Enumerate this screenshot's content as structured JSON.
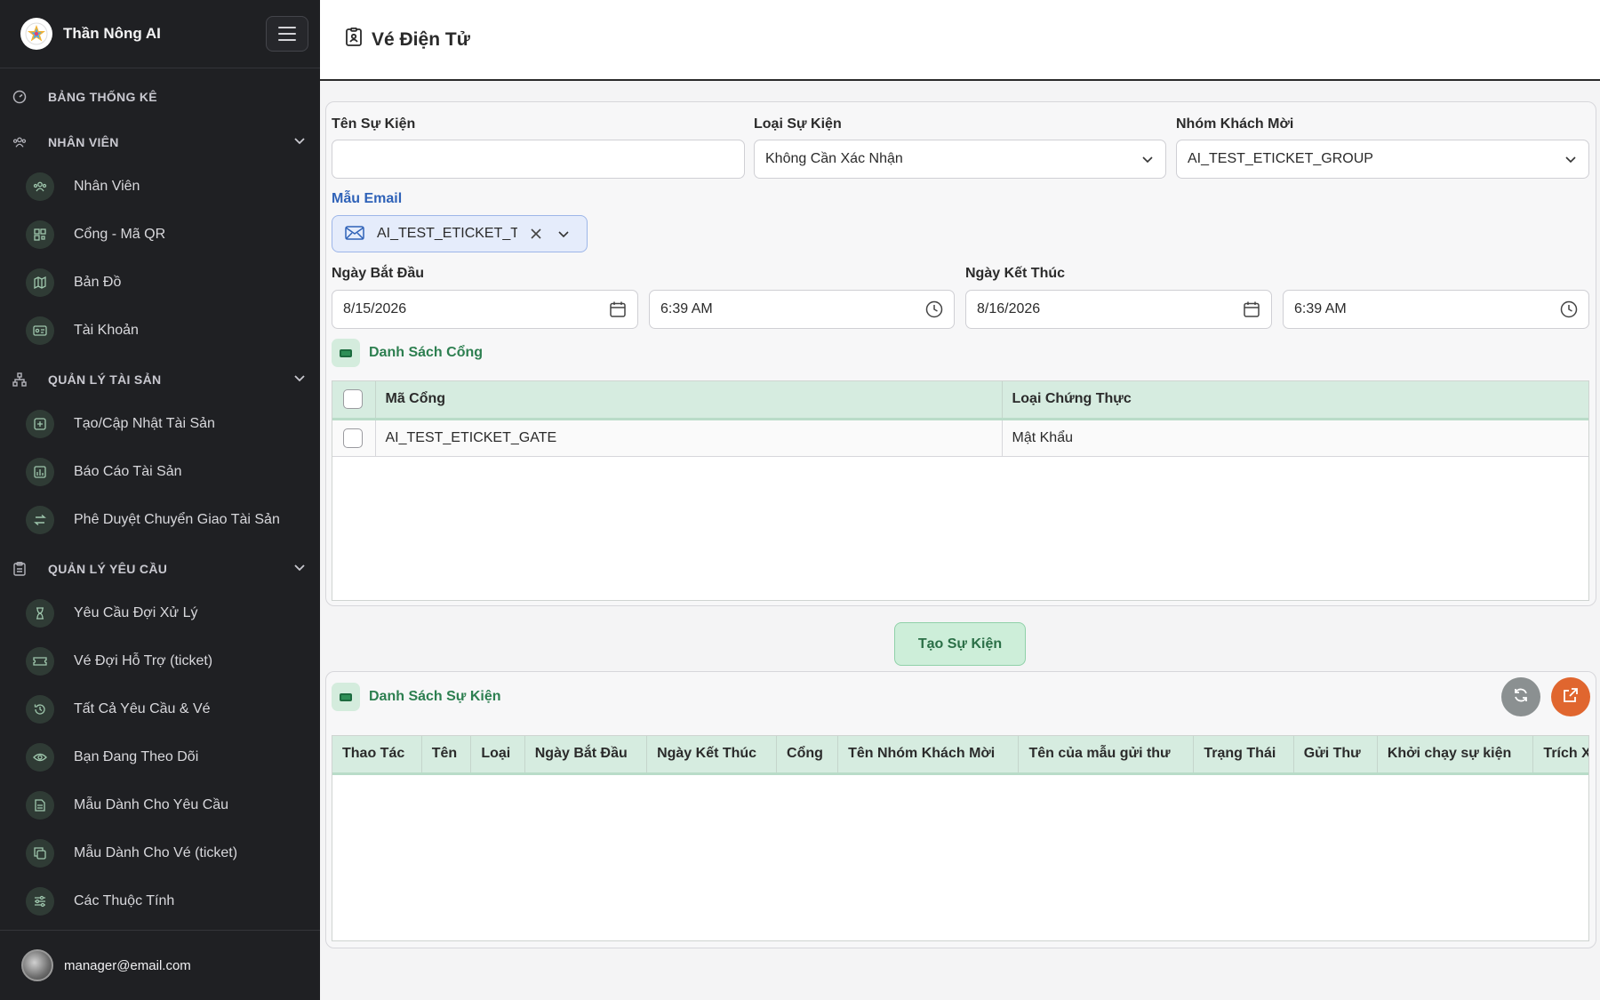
{
  "sidebar": {
    "brand": "Thần Nông AI",
    "sections": {
      "dashboard": "BẢNG THỐNG KÊ",
      "staff": "NHÂN VIÊN",
      "assets": "QUẢN LÝ TÀI SẢN",
      "requests": "QUẢN LÝ YÊU CẦU"
    },
    "items": {
      "staff": "Nhân Viên",
      "gate_qr": "Cổng - Mã QR",
      "map": "Bản Đồ",
      "account": "Tài Khoản",
      "asset_update": "Tạo/Cập Nhật Tài Sản",
      "asset_report": "Báo Cáo Tài Sản",
      "asset_transfer": "Phê Duyệt Chuyển Giao Tài Sản",
      "pending": "Yêu Cầu Đợi Xử Lý",
      "support_ticket": "Vé Đợi Hỗ Trợ (ticket)",
      "all_requests": "Tất Cả Yêu Cầu & Vé",
      "following": "Bạn Đang Theo Dõi",
      "request_templates": "Mẫu Dành Cho Yêu Cầu",
      "ticket_templates": "Mẫu Dành Cho Vé (ticket)",
      "attributes": "Các Thuộc Tính"
    },
    "user_email": "manager@email.com"
  },
  "header": {
    "title": "Vé Điện Tử"
  },
  "form": {
    "event_name_label": "Tên Sự Kiện",
    "event_name_value": "",
    "event_type_label": "Loại Sự Kiện",
    "event_type_value": "Không Cần Xác Nhận",
    "guest_group_label": "Nhóm Khách Mời",
    "guest_group_value": "AI_TEST_ETICKET_GROUP",
    "email_template_label": "Mẫu Email",
    "email_template_value": "AI_TEST_ETICKET_TI",
    "start_label": "Ngày Bắt Đầu",
    "start_date": "8/15/2026",
    "start_time": "6:39 AM",
    "end_label": "Ngày Kết Thúc",
    "end_date": "8/16/2026",
    "end_time": "6:39 AM"
  },
  "gates": {
    "title": "Danh Sách Cổng",
    "col_code": "Mã Cổng",
    "col_auth": "Loại Chứng Thực",
    "rows": [
      {
        "code": "AI_TEST_ETICKET_GATE",
        "auth": "Mật Khẩu"
      }
    ]
  },
  "create_button": "Tạo Sự Kiện",
  "events": {
    "title": "Danh Sách Sự Kiện",
    "columns": [
      "Thao Tác",
      "Tên",
      "Loại",
      "Ngày Bắt Đầu",
      "Ngày Kết Thúc",
      "Cổng",
      "Tên Nhóm Khách Mời",
      "Tên của mẫu gửi thư",
      "Trạng Thái",
      "Gửi Thư",
      "Khởi chạy sự kiện",
      "Trích Xuất"
    ]
  },
  "colors": {
    "sidebar_bg": "#1f2023",
    "accent_green": "#2d7f50",
    "header_green": "#d6ece0",
    "export_orange": "#e0662f"
  }
}
